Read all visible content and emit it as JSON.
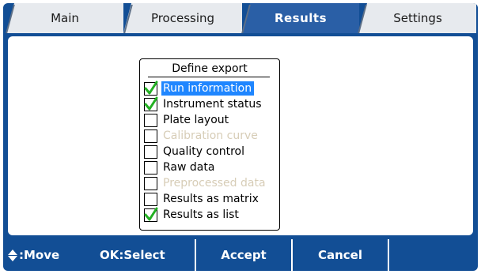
{
  "tabs": [
    {
      "label": "Main",
      "active": false
    },
    {
      "label": "Processing",
      "active": false
    },
    {
      "label": "Results",
      "active": true
    },
    {
      "label": "Settings",
      "active": false
    }
  ],
  "dialog": {
    "title": "Define export",
    "options": [
      {
        "label": "Run information",
        "checked": true,
        "enabled": true,
        "selected": true
      },
      {
        "label": "Instrument status",
        "checked": true,
        "enabled": true,
        "selected": false
      },
      {
        "label": "Plate layout",
        "checked": false,
        "enabled": true,
        "selected": false
      },
      {
        "label": "Calibration curve",
        "checked": false,
        "enabled": false,
        "selected": false
      },
      {
        "label": "Quality control",
        "checked": false,
        "enabled": true,
        "selected": false
      },
      {
        "label": "Raw data",
        "checked": false,
        "enabled": true,
        "selected": false
      },
      {
        "label": "Preprocessed data",
        "checked": false,
        "enabled": false,
        "selected": false
      },
      {
        "label": "Results as matrix",
        "checked": false,
        "enabled": true,
        "selected": false
      },
      {
        "label": "Results as list",
        "checked": true,
        "enabled": true,
        "selected": false
      }
    ]
  },
  "bottom_bar": {
    "move_label": ":Move",
    "move_icon": "up-down-arrows-icon",
    "select_label": "OK:Select",
    "accept_label": "Accept",
    "cancel_label": "Cancel"
  },
  "colors": {
    "frame": "#124e95",
    "active_tab": "#2a5fa6",
    "selection": "#1f86ff",
    "checkmark": "#22b022",
    "disabled_text": "#d7cdb7"
  }
}
